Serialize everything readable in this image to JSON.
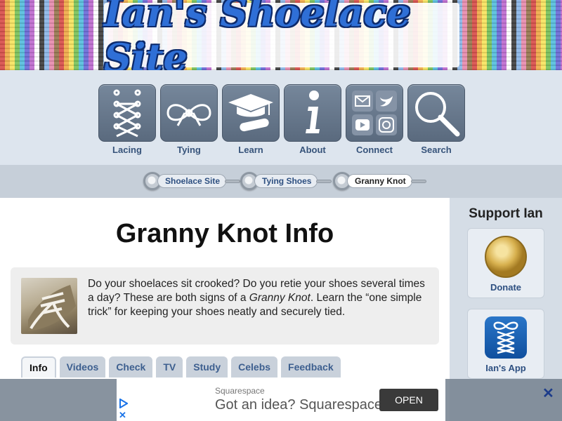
{
  "banner": {
    "title": "Ian's Shoelace Site"
  },
  "nav": {
    "items": [
      {
        "label": "Lacing",
        "icon": "lacing-icon"
      },
      {
        "label": "Tying",
        "icon": "bow-knot-icon"
      },
      {
        "label": "Learn",
        "icon": "graduation-cap-icon"
      },
      {
        "label": "About",
        "icon": "info-icon"
      },
      {
        "label": "Connect",
        "icon": "social-icons"
      },
      {
        "label": "Search",
        "icon": "magnifier-icon"
      }
    ]
  },
  "breadcrumb": {
    "items": [
      {
        "label": "Shoelace Site"
      },
      {
        "label": "Tying Shoes"
      },
      {
        "label": "Granny Knot"
      }
    ]
  },
  "main": {
    "title": "Granny Knot Info",
    "intro": {
      "part1": "Do your shoelaces sit crooked? Do you retie your shoes several times a day? These are both signs of a ",
      "emph": "Granny Knot",
      "part2": ". Learn the “one simple trick” for keeping your shoes neatly and securely tied."
    },
    "tabs": [
      "Info",
      "Videos",
      "Check",
      "TV",
      "Study",
      "Celebs",
      "Feedback"
    ],
    "active_tab": "Info"
  },
  "sidebar": {
    "title": "Support Ian",
    "donate_label": "Donate",
    "app_label": "Ian's App"
  },
  "ad": {
    "brand": "Squarespace",
    "headline": "Got an idea? Squarespace",
    "cta": "OPEN"
  },
  "colors": {
    "nav_tile": "#5f6f84",
    "nav_label": "#36537a",
    "tab_bg": "#c9d1db",
    "sidebar_bg": "#d5dde6"
  }
}
